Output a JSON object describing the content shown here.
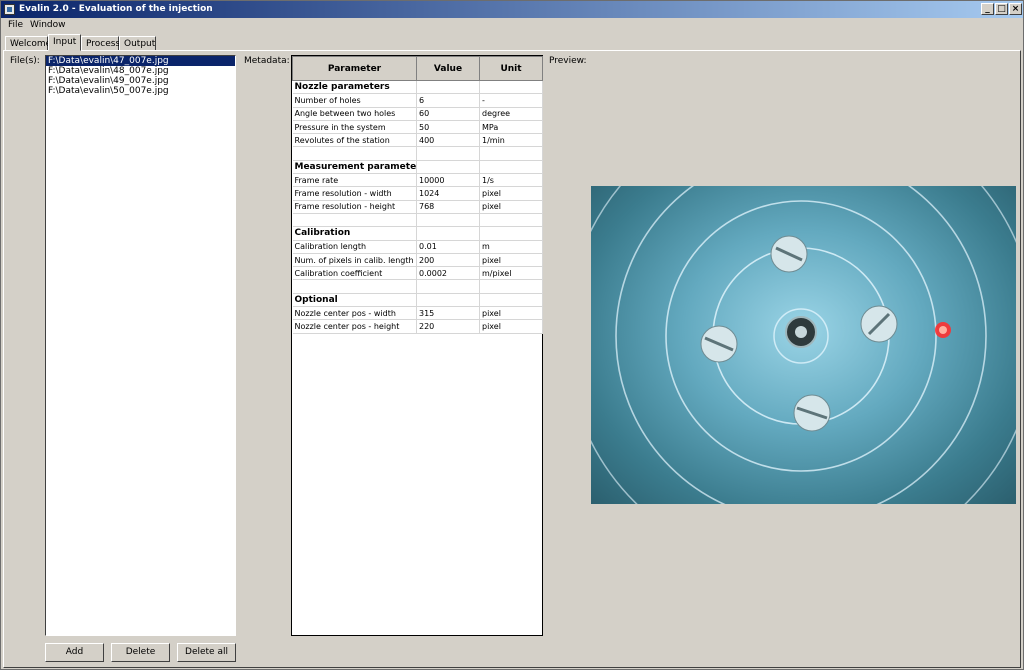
{
  "window": {
    "title": "Evalin 2.0 - Evaluation of the injection"
  },
  "menu": {
    "file": "File",
    "window": "Window"
  },
  "tabs": [
    {
      "label": "Welcome"
    },
    {
      "label": "Input"
    },
    {
      "label": "Process"
    },
    {
      "label": "Output"
    }
  ],
  "files": {
    "label": "File(s):",
    "items": [
      "F:\\Data\\evalin\\47_007e.jpg",
      "F:\\Data\\evalin\\48_007e.jpg",
      "F:\\Data\\evalin\\49_007e.jpg",
      "F:\\Data\\evalin\\50_007e.jpg"
    ],
    "selected_index": 0,
    "buttons": {
      "add": "Add",
      "delete": "Delete",
      "delete_all": "Delete all"
    }
  },
  "metadata": {
    "label": "Metadata:",
    "headers": {
      "parameter": "Parameter",
      "value": "Value",
      "unit": "Unit"
    },
    "sections": [
      {
        "title": "Nozzle parameters",
        "rows": [
          {
            "parameter": "Number of holes",
            "value": "6",
            "unit": "-"
          },
          {
            "parameter": "Angle between two holes",
            "value": "60",
            "unit": "degree"
          },
          {
            "parameter": "Pressure in the system",
            "value": "50",
            "unit": "MPa"
          },
          {
            "parameter": "Revolutes of the station",
            "value": "400",
            "unit": "1/min"
          }
        ]
      },
      {
        "title": "Measurement parameters",
        "rows": [
          {
            "parameter": "Frame rate",
            "value": "10000",
            "unit": "1/s"
          },
          {
            "parameter": "Frame resolution - width",
            "value": "1024",
            "unit": "pixel"
          },
          {
            "parameter": "Frame resolution - height",
            "value": "768",
            "unit": "pixel"
          }
        ]
      },
      {
        "title": "Calibration",
        "rows": [
          {
            "parameter": "Calibration length",
            "value": "0.01",
            "unit": "m"
          },
          {
            "parameter": "Num. of pixels in calib. length",
            "value": "200",
            "unit": "pixel"
          },
          {
            "parameter": "Calibration coefficient",
            "value": "0.0002",
            "unit": "m/pixel"
          }
        ]
      },
      {
        "title": "Optional",
        "rows": [
          {
            "parameter": "Nozzle center pos - width",
            "value": "315",
            "unit": "pixel"
          },
          {
            "parameter": "Nozzle center pos - height",
            "value": "220",
            "unit": "pixel"
          }
        ]
      }
    ]
  },
  "preview": {
    "label": "Preview:"
  },
  "colors": {
    "title_start": "#0a246a",
    "title_end": "#a6caf0",
    "selection": "#0a246a",
    "marker": "#ff3030"
  }
}
